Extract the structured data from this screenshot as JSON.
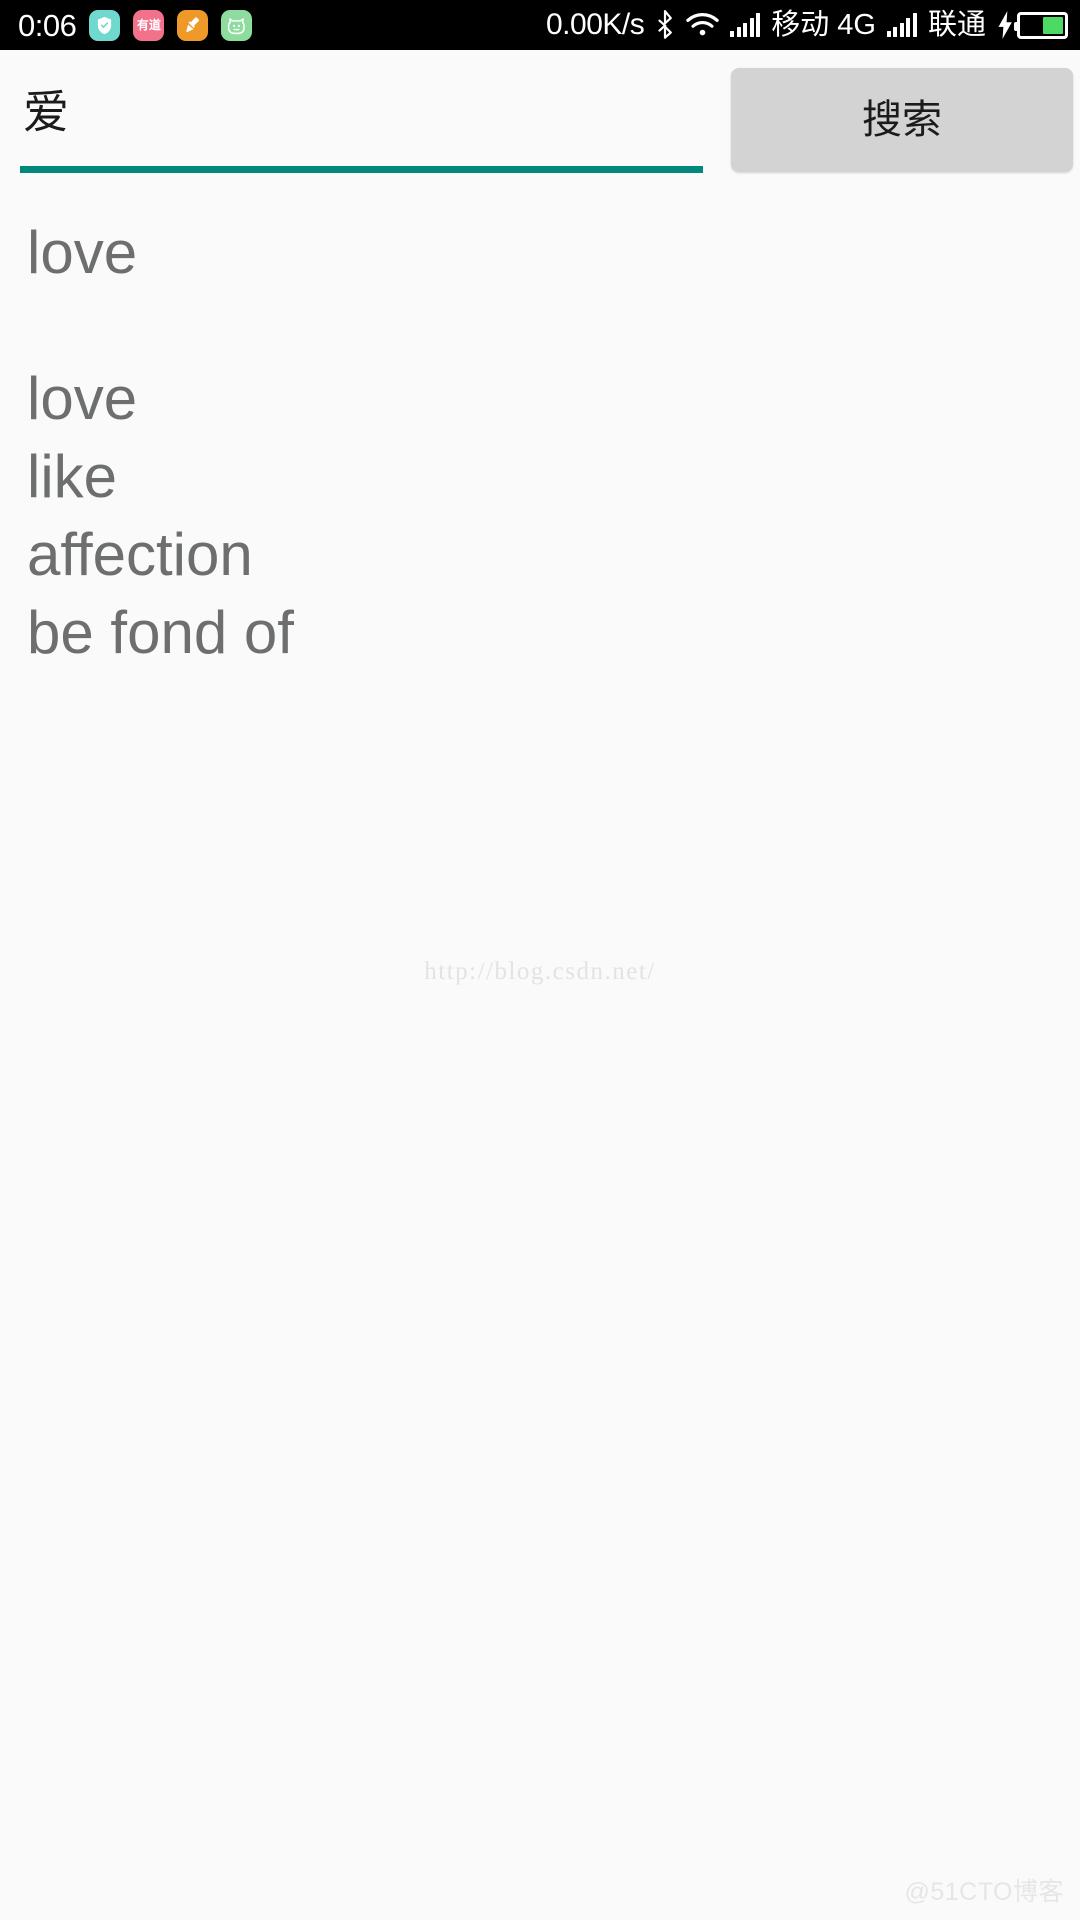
{
  "status_bar": {
    "clock": "0:06",
    "net_speed": "0.00K/s",
    "tray_icons": [
      {
        "name": "shield-check-icon",
        "bg": "#6fd8cf",
        "label": ""
      },
      {
        "name": "youdao-dictionary-icon",
        "bg": "#f2728c",
        "label": "有道"
      },
      {
        "name": "brush-cleaner-icon",
        "bg": "#ef9a28",
        "label": ""
      },
      {
        "name": "cat-face-icon",
        "bg": "#8edd9f",
        "label": ""
      }
    ],
    "bluetooth_icon": "bluetooth-icon",
    "wifi_icon": "wifi-icon",
    "signal_icon": "signal-bars-icon",
    "carrier_primary": "移动 4G",
    "carrier_secondary": "联通",
    "charging_icon": "charging-bolt-icon",
    "battery_icon": "battery-icon",
    "battery_level_percent": 48,
    "battery_fill_color": "#4cd964",
    "background_color": "#000000",
    "foreground_color": "#ffffff"
  },
  "search": {
    "input_value": "爱",
    "input_placeholder": "",
    "underline_color": "#00897a",
    "button_label": "搜索",
    "button_color": "#d2d3d2"
  },
  "results": {
    "headword": "love",
    "senses": [
      "love",
      "like",
      "affection",
      "be fond of"
    ],
    "text_color": "#6d6e6e"
  },
  "watermarks": {
    "center": "http://blog.csdn.net/",
    "corner": "@51CTO博客"
  },
  "page": {
    "background_color": "#fafafa"
  }
}
